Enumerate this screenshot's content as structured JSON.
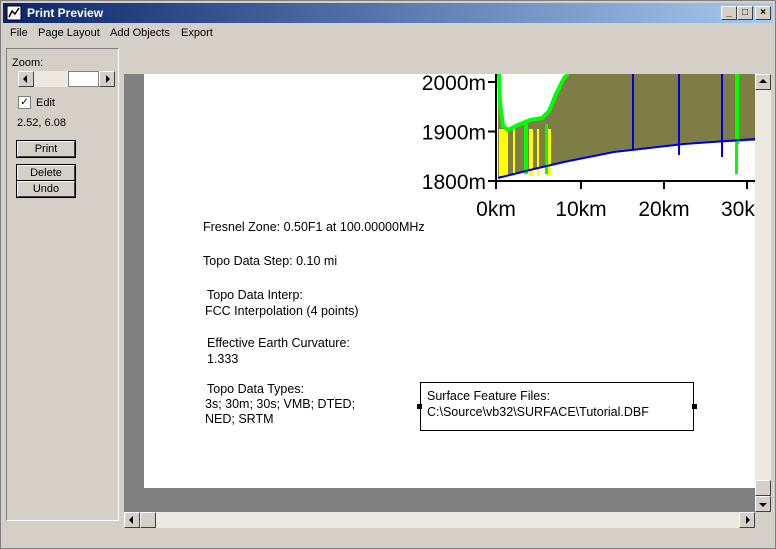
{
  "window": {
    "title": "Print Preview",
    "controls": {
      "minimize": "_",
      "maximize": "□",
      "close": "×"
    }
  },
  "menu": [
    "File",
    "Page Layout",
    "Add Objects",
    "Export"
  ],
  "panel": {
    "zoom_label": "Zoom:",
    "edit_checked": true,
    "edit_label": "Edit",
    "check_mark": "✓",
    "coords": "2.52, 6.08",
    "print_button": "Print",
    "delete_button": "Delete",
    "undo_button": "Undo"
  },
  "chart_data": {
    "type": "area",
    "y_tick_labels": [
      "2000m",
      "1900m",
      "1800m"
    ],
    "x_tick_labels": [
      "0km",
      "10km",
      "20km",
      "30k"
    ],
    "ylim": [
      1800,
      2000
    ]
  },
  "page_text": {
    "fresnel": "Fresnel Zone: 0.50F1 at 100.00000MHz",
    "topo_step": "Topo Data Step: 0.10 mi",
    "topo_interp_label": "Topo Data Interp:",
    "topo_interp_value": "FCC Interpolation (4 points)",
    "curvature_label": "Effective Earth Curvature:",
    "curvature_value": "1.333",
    "types_label": "Topo Data Types:",
    "types_line1": "3s; 30m; 30s; VMB; DTED;",
    "types_line2": "NED; SRTM",
    "surface_label": "Surface Feature Files:",
    "surface_value": "C:\\Source\\vb32\\SURFACE\\Tutorial.DBF"
  },
  "colors": {
    "terrain": "#7f7d46",
    "fresnel": "#00ff00",
    "yellow": "#ffff00",
    "blue": "#0000dd"
  }
}
